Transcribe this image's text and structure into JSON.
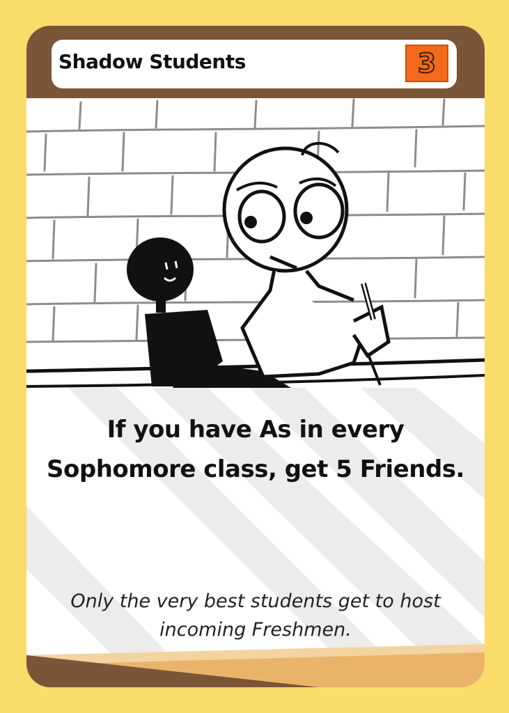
{
  "card": {
    "title": "Shadow Students",
    "cost": "3",
    "effect_lines": [
      "If you have As in every",
      "Sophomore class, get 5 Friends."
    ],
    "flavor_lines": [
      "Only the very best students get to host",
      "incoming Freshmen."
    ],
    "colors": {
      "background": "#f9dc6a",
      "header": "#7a5538",
      "cost_badge": "#f26a1b",
      "footer_band": "#e9b46a"
    }
  },
  "illustration": "student-with-shadow-doodle"
}
